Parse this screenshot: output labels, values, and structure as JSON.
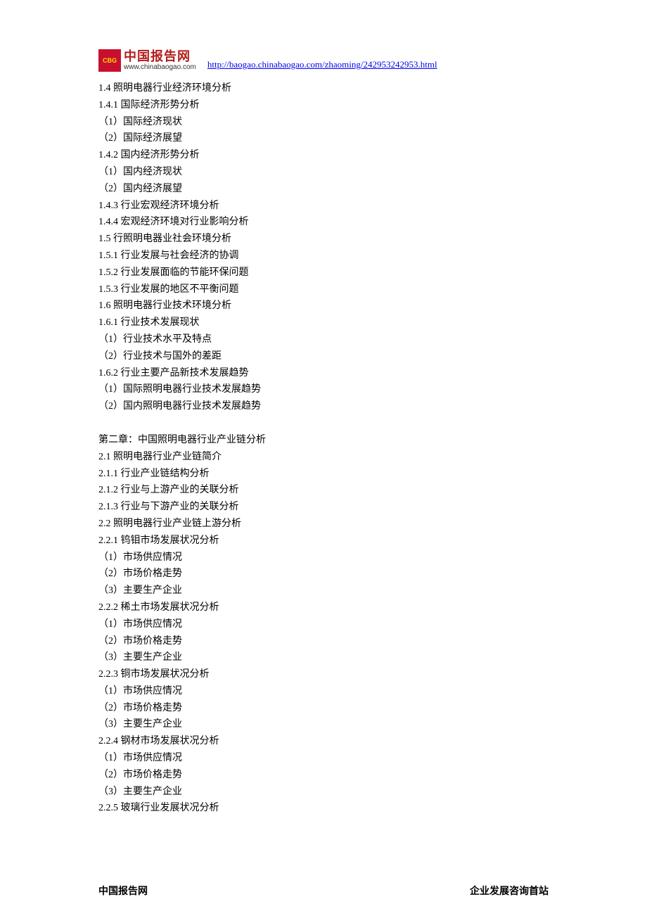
{
  "header": {
    "logo_cn": "中国报告网",
    "logo_en": "www.chinabaogao.com",
    "logo_badge": "CBG",
    "url": "http://baogao.chinabaogao.com/zhaoming/242953242953.html"
  },
  "toc": [
    "1.4 照明电器行业经济环境分析",
    "1.4.1 国际经济形势分析",
    "（1）国际经济现状",
    "（2）国际经济展望",
    "1.4.2 国内经济形势分析",
    "（1）国内经济现状",
    "（2）国内经济展望",
    "1.4.3 行业宏观经济环境分析",
    "1.4.4 宏观经济环境对行业影响分析",
    "1.5 行照明电器业社会环境分析",
    "1.5.1 行业发展与社会经济的协调",
    "1.5.2 行业发展面临的节能环保问题",
    "1.5.3 行业发展的地区不平衡问题",
    "1.6 照明电器行业技术环境分析",
    "1.6.1 行业技术发展现状",
    "（1）行业技术水平及特点",
    "（2）行业技术与国外的差距",
    "1.6.2 行业主要产品新技术发展趋势",
    "（1）国际照明电器行业技术发展趋势",
    "（2）国内照明电器行业技术发展趋势",
    "",
    "第二章：中国照明电器行业产业链分析",
    "2.1 照明电器行业产业链简介",
    "2.1.1 行业产业链结构分析",
    "2.1.2 行业与上游产业的关联分析",
    "2.1.3 行业与下游产业的关联分析",
    "2.2 照明电器行业产业链上游分析",
    "2.2.1 钨钼市场发展状况分析",
    "（1）市场供应情况",
    "（2）市场价格走势",
    "（3）主要生产企业",
    "2.2.2 稀土市场发展状况分析",
    "（1）市场供应情况",
    "（2）市场价格走势",
    "（3）主要生产企业",
    "2.2.3 铜市场发展状况分析",
    "（1）市场供应情况",
    "（2）市场价格走势",
    "（3）主要生产企业",
    "2.2.4 钢材市场发展状况分析",
    "（1）市场供应情况",
    "（2）市场价格走势",
    "（3）主要生产企业",
    "2.2.5 玻璃行业发展状况分析"
  ],
  "footer": {
    "left": "中国报告网",
    "right": "企业发展咨询首站"
  }
}
